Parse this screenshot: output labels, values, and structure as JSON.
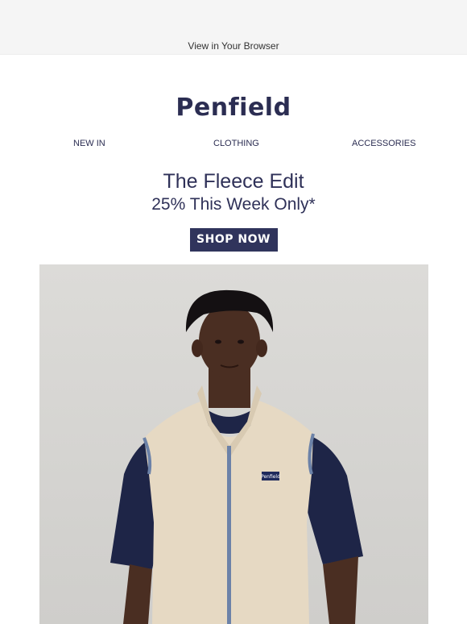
{
  "top_bar": {
    "view_in_browser": "View in Your Browser"
  },
  "brand": {
    "logo_text": "Penfield",
    "accent_color": "#2b2d52"
  },
  "nav": {
    "items": [
      "NEW IN",
      "CLOTHING",
      "ACCESSORIES"
    ]
  },
  "hero_text": {
    "headline": "The Fleece Edit",
    "subline": "25% This Week Only*"
  },
  "cta": {
    "label": "SHOP NOW",
    "color": "#30345c"
  },
  "hero_image": {
    "alt": "Model wearing Penfield fleece vest",
    "badge_text": "Penfield"
  }
}
